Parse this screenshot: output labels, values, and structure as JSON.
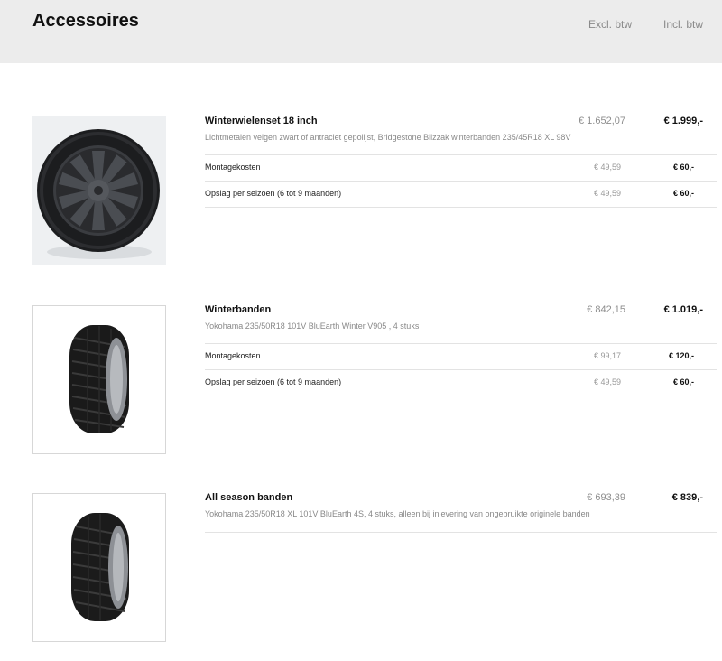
{
  "header": {
    "title": "Accessoires",
    "col_excl": "Excl. btw",
    "col_incl": "Incl. btw"
  },
  "products": [
    {
      "name": "Winterwielenset 18 inch",
      "description": "Lichtmetalen velgen zwart of antraciet gepolijst, Bridgestone Blizzak winterbanden 235/45R18 XL 98V",
      "price_excl": "€ 1.652,07",
      "price_incl": "€ 1.999,-",
      "image": "alloy-wheel-image",
      "options": [
        {
          "label": "Montagekosten",
          "excl": "€ 49,59",
          "incl": "€ 60,-"
        },
        {
          "label": "Opslag per seizoen (6 tot 9 maanden)",
          "excl": "€ 49,59",
          "incl": "€ 60,-"
        }
      ]
    },
    {
      "name": "Winterbanden",
      "description": "Yokohama 235/50R18 101V BluEarth Winter V905 , 4 stuks",
      "price_excl": "€ 842,15",
      "price_incl": "€ 1.019,-",
      "image": "winter-tire-image",
      "options": [
        {
          "label": "Montagekosten",
          "excl": "€ 99,17",
          "incl": "€ 120,-"
        },
        {
          "label": "Opslag per seizoen (6 tot 9 maanden)",
          "excl": "€ 49,59",
          "incl": "€ 60,-"
        }
      ]
    },
    {
      "name": "All season banden",
      "description": "Yokohama 235/50R18 XL 101V BluEarth 4S, 4 stuks, alleen bij inlevering van ongebruikte originele banden",
      "price_excl": "€ 693,39",
      "price_incl": "€ 839,-",
      "image": "all-season-tire-image",
      "options": []
    }
  ]
}
